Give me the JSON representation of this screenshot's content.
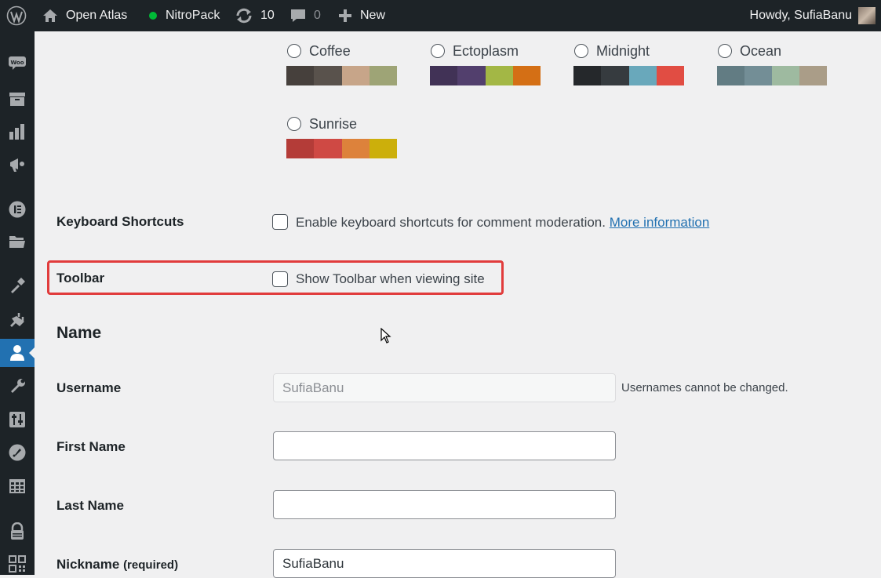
{
  "adminbar": {
    "site_name": "Open Atlas",
    "nitropack": "NitroPack",
    "updates_count": "10",
    "comments_count": "0",
    "new_label": "New",
    "howdy": "Howdy, SufiaBanu",
    "icons": [
      "wordpress-logo-icon",
      "home-icon",
      "status-dot-icon",
      "updates-icon",
      "comment-icon",
      "plus-icon"
    ],
    "status_color": "#00ba37"
  },
  "sidebar": {
    "icons": [
      "woocommerce-icon",
      "archive-icon",
      "analytics-icon",
      "marketing-icon",
      "elementor-icon",
      "templates-icon",
      "appearance-icon",
      "plugins-icon",
      "users-icon",
      "tools-icon",
      "settings-icon",
      "rocket-icon",
      "table-icon",
      "security-icon",
      "qr-icon"
    ],
    "active": "users-icon",
    "active_color": "#2271b1"
  },
  "color_schemes": [
    {
      "name": "Coffee",
      "colors": [
        "#46403c",
        "#59524c",
        "#c7a589",
        "#9ea476"
      ]
    },
    {
      "name": "Ectoplasm",
      "colors": [
        "#413256",
        "#523f6d",
        "#a3b745",
        "#d46f15"
      ]
    },
    {
      "name": "Midnight",
      "colors": [
        "#25282b",
        "#363b3f",
        "#69a8bb",
        "#e14d43"
      ]
    },
    {
      "name": "Ocean",
      "colors": [
        "#627c83",
        "#738e96",
        "#9ebaa0",
        "#aa9d88"
      ]
    },
    {
      "name": "Sunrise",
      "colors": [
        "#b43c38",
        "#cf4944",
        "#dd823b",
        "#ccaf0b"
      ]
    }
  ],
  "keyboard": {
    "label": "Keyboard Shortcuts",
    "checkbox_text": "Enable keyboard shortcuts for comment moderation.",
    "link_text": "More information"
  },
  "toolbar": {
    "label": "Toolbar",
    "checkbox_text": "Show Toolbar when viewing site",
    "highlight_color": "#e13c3c"
  },
  "name_section": {
    "title": "Name",
    "username_label": "Username",
    "username_value": "SufiaBanu",
    "username_desc": "Usernames cannot be changed.",
    "first_name_label": "First Name",
    "first_name_value": "",
    "last_name_label": "Last Name",
    "last_name_value": "",
    "nickname_label": "Nickname",
    "nickname_required": "(required)",
    "nickname_value": "SufiaBanu"
  }
}
